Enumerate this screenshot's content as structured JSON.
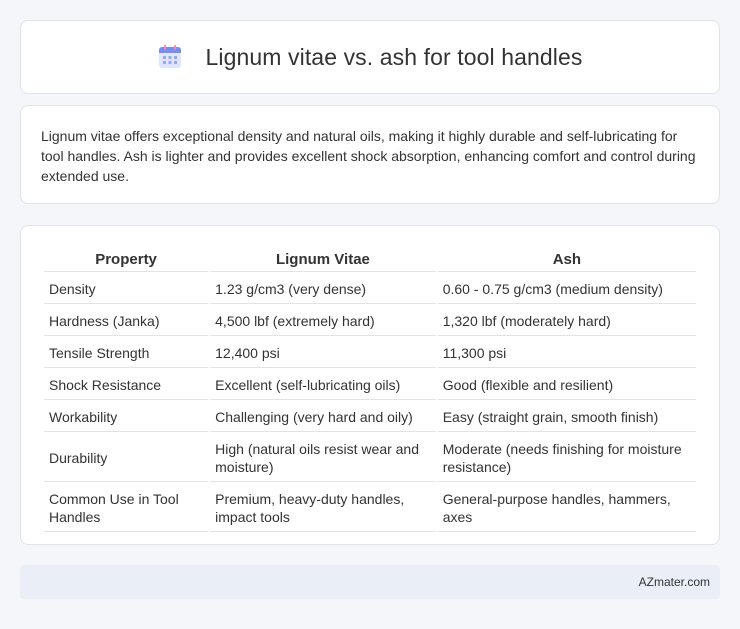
{
  "header": {
    "icon": "calendar-icon",
    "title": "Lignum vitae vs. ash for tool handles"
  },
  "intro": {
    "text": "Lignum vitae offers exceptional density and natural oils, making it highly durable and self-lubricating for tool handles. Ash is lighter and provides excellent shock absorption, enhancing comfort and control during extended use."
  },
  "table": {
    "headers": [
      "Property",
      "Lignum Vitae",
      "Ash"
    ],
    "rows": [
      [
        "Density",
        "1.23 g/cm3 (very dense)",
        "0.60 - 0.75 g/cm3 (medium density)"
      ],
      [
        "Hardness (Janka)",
        "4,500 lbf (extremely hard)",
        "1,320 lbf (moderately hard)"
      ],
      [
        "Tensile Strength",
        "12,400 psi",
        "11,300 psi"
      ],
      [
        "Shock Resistance",
        "Excellent (self-lubricating oils)",
        "Good (flexible and resilient)"
      ],
      [
        "Workability",
        "Challenging (very hard and oily)",
        "Easy (straight grain, smooth finish)"
      ],
      [
        "Durability",
        "High (natural oils resist wear and moisture)",
        "Moderate (needs finishing for moisture resistance)"
      ],
      [
        "Common Use in Tool Handles",
        "Premium, heavy-duty handles, impact tools",
        "General-purpose handles, hammers, axes"
      ]
    ]
  },
  "footer": {
    "brand": "AZmater.com"
  }
}
